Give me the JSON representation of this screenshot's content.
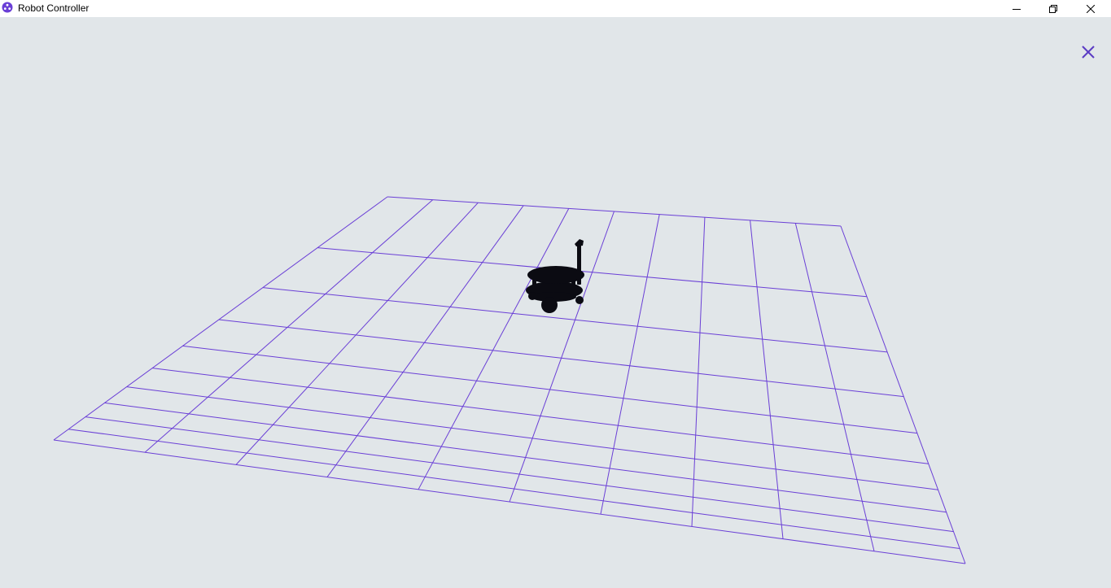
{
  "window": {
    "title": "Robot Controller",
    "icon": "robot-app-icon",
    "controls": [
      "minimize-icon",
      "restore-icon",
      "close-icon"
    ]
  },
  "viewport": {
    "background_color": "#e1e6e9",
    "grid": {
      "line_color": "#6a3fd6",
      "rows": 10,
      "columns": 10
    },
    "robot": {
      "color": "#0b0b12"
    },
    "overlay_close": {
      "icon": "close-icon",
      "color": "#5b3cc4"
    }
  }
}
